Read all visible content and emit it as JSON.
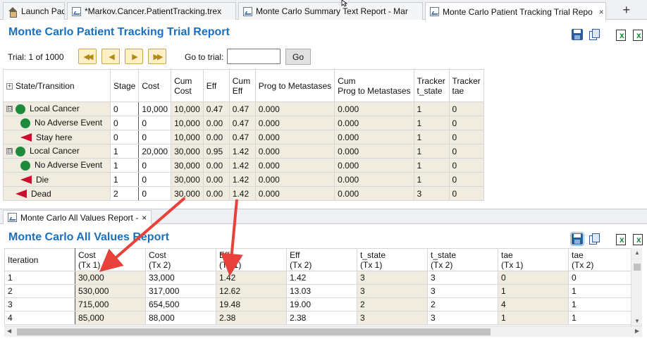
{
  "tabs": [
    {
      "label": "Launch Pad",
      "icon": "home-icon",
      "active": false
    },
    {
      "label": "*Markov.Cancer.PatientTracking.trex",
      "icon": "model-file-icon",
      "active": false
    },
    {
      "label": "Monte Carlo Summary Text Report - Mar",
      "icon": "report-icon",
      "active": false
    },
    {
      "label": "Monte Carlo Patient Tracking Trial Repo",
      "icon": "report-icon",
      "active": true,
      "close": "×"
    }
  ],
  "new_tab": "+",
  "trial_report": {
    "title": "Monte Carlo Patient Tracking Trial Report",
    "trial_label": "Trial: 1 of 1000",
    "nav_buttons": [
      "first",
      "previous",
      "next",
      "last"
    ],
    "goto_label": "Go to trial:",
    "goto_value": "",
    "go_label": "Go",
    "columns": [
      [
        "State/Transition"
      ],
      [
        "Stage"
      ],
      [
        "Cost"
      ],
      [
        "Cum",
        "Cost"
      ],
      [
        "Eff"
      ],
      [
        "Cum",
        "Eff"
      ],
      [
        "Prog to Metastases"
      ],
      [
        "Cum",
        "Prog to Metastases"
      ],
      [
        "Tracker",
        "t_state"
      ],
      [
        "Tracker",
        "tae"
      ]
    ],
    "rows": [
      {
        "name": "Local Cancer",
        "node": "circle",
        "level": 0,
        "expander": "⊟",
        "values": [
          "0",
          "10,000",
          "10,000",
          "0.47",
          "0.47",
          "0.000",
          "0.000",
          "1",
          "0"
        ]
      },
      {
        "name": "No Adverse Event",
        "node": "circle",
        "level": 1,
        "values": [
          "0",
          "0",
          "10,000",
          "0.00",
          "0.47",
          "0.000",
          "0.000",
          "1",
          "0"
        ]
      },
      {
        "name": "Stay here",
        "node": "triangle",
        "level": 1,
        "values": [
          "0",
          "0",
          "10,000",
          "0.00",
          "0.47",
          "0.000",
          "0.000",
          "1",
          "0"
        ]
      },
      {
        "name": "Local Cancer",
        "node": "circle",
        "level": 0,
        "expander": "⊟",
        "values": [
          "1",
          "20,000",
          "30,000",
          "0.95",
          "1.42",
          "0.000",
          "0.000",
          "1",
          "0"
        ]
      },
      {
        "name": "No Adverse Event",
        "node": "circle",
        "level": 1,
        "values": [
          "1",
          "0",
          "30,000",
          "0.00",
          "1.42",
          "0.000",
          "0.000",
          "1",
          "0"
        ]
      },
      {
        "name": "Die",
        "node": "triangle",
        "level": 1,
        "values": [
          "1",
          "0",
          "30,000",
          "0.00",
          "1.42",
          "0.000",
          "0.000",
          "1",
          "0"
        ]
      },
      {
        "name": "Dead",
        "node": "triangle",
        "level": 0,
        "values": [
          "2",
          "0",
          "30,000",
          "0.00",
          "1.42",
          "0.000",
          "0.000",
          "3",
          "0"
        ]
      }
    ]
  },
  "all_values_report": {
    "tab_label": "Monte Carlo All Values Report -",
    "tab_close": "×",
    "title": "Monte Carlo All Values Report",
    "columns": [
      [
        "Iteration",
        ""
      ],
      [
        "Cost",
        "(Tx 1)"
      ],
      [
        "Cost",
        "(Tx 2)"
      ],
      [
        "Eff",
        "(Tx 1)"
      ],
      [
        "Eff",
        "(Tx 2)"
      ],
      [
        "t_state",
        "(Tx 1)"
      ],
      [
        "t_state",
        "(Tx 2)"
      ],
      [
        "tae",
        "(Tx 1)"
      ],
      [
        "tae",
        "(Tx 2)"
      ]
    ],
    "rows": [
      [
        "1",
        "30,000",
        "33,000",
        "1.42",
        "1.42",
        "3",
        "3",
        "0",
        "0"
      ],
      [
        "2",
        "530,000",
        "317,000",
        "12.62",
        "13.03",
        "3",
        "3",
        "1",
        "1"
      ],
      [
        "3",
        "715,000",
        "654,500",
        "19.48",
        "19.00",
        "2",
        "2",
        "4",
        "1"
      ],
      [
        "4",
        "85,000",
        "88,000",
        "2.38",
        "2.38",
        "3",
        "3",
        "1",
        "1"
      ]
    ]
  },
  "colors": {
    "title": "#1b6fbf",
    "arrow": "#e8413c",
    "shade": "#f1ece0",
    "node_circle": "#1e8a3c",
    "node_triangle": "#c8102e"
  }
}
